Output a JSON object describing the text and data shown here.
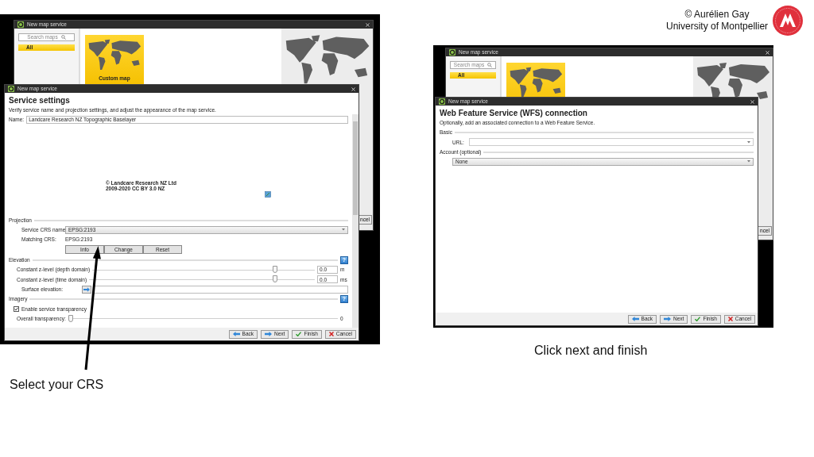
{
  "credit": {
    "lines": [
      "© Aurélien Gay",
      "University of Montpellier"
    ]
  },
  "screenshots": [
    {
      "back_window": {
        "title": "New map service",
        "search": {
          "placeholder": "Search maps"
        },
        "categories": [
          {
            "label": "All",
            "selected": true
          }
        ],
        "tiles": [
          {
            "label": "Custom map"
          }
        ],
        "partial_button": "ncel"
      },
      "front_window": {
        "title": "New map service",
        "heading": "Service settings",
        "description": "Verify service name and projection settings, and adjust the appearance of the map service.",
        "rows": [
          {
            "kind": "text_field",
            "label": "Name:",
            "value": "Landcare Research NZ Topographic Baselayer"
          },
          {
            "kind": "map_preview",
            "attribution": [
              "© Landcare Research NZ Ltd",
              "2009-2020 CC BY 3.0 NZ"
            ]
          },
          {
            "kind": "section",
            "label": "Projection"
          },
          {
            "kind": "dropdown",
            "label": "Service CRS name:",
            "value": "EPSG:2193"
          },
          {
            "kind": "readout",
            "label": "Matching CRS:",
            "value": "EPSG:2193"
          },
          {
            "kind": "buttons",
            "buttons": [
              "Info",
              "Change",
              "Reset"
            ]
          },
          {
            "kind": "section",
            "label": "Elevation",
            "help": "?"
          },
          {
            "kind": "slider",
            "label": "Constant z-level (depth domain)",
            "level": 0.83,
            "value": "0.0",
            "unit": "m"
          },
          {
            "kind": "slider",
            "label": "Constant z-level (time domain)",
            "level": 0.83,
            "value": "0.0",
            "unit": "ms"
          },
          {
            "kind": "picker",
            "label": "Surface elevation:"
          },
          {
            "kind": "section",
            "label": "Imagery",
            "help": "?"
          },
          {
            "kind": "checkbox",
            "label": "Enable service transparency",
            "checked": true
          },
          {
            "kind": "slider",
            "label": "Overall transparency:",
            "level": 0,
            "reading": "0"
          }
        ],
        "buttons": [
          {
            "kind": "back",
            "label": "Back"
          },
          {
            "kind": "next",
            "label": "Next"
          },
          {
            "kind": "finish",
            "label": "Finish"
          },
          {
            "kind": "cancel",
            "label": "Cancel"
          }
        ]
      },
      "caption": "Select your CRS"
    },
    {
      "back_window": {
        "title": "New map service",
        "search": {
          "placeholder": "Search maps"
        },
        "categories": [
          {
            "label": "All",
            "selected": true
          }
        ],
        "tiles_visible": true,
        "partial_button": "ncel"
      },
      "front_window": {
        "title": "New map service",
        "heading": "Web Feature Service (WFS) connection",
        "description": "Optionally, add an associated connection to a Web Feature Service.",
        "rows": [
          {
            "kind": "section",
            "label": "Basic"
          },
          {
            "kind": "combo_box",
            "label": "URL:"
          },
          {
            "kind": "section",
            "label": "Account (optional)"
          },
          {
            "kind": "dropdown",
            "value": "None"
          }
        ],
        "buttons": [
          {
            "kind": "back",
            "label": "Back"
          },
          {
            "kind": "next",
            "label": "Next"
          },
          {
            "kind": "finish",
            "label": "Finish"
          },
          {
            "kind": "cancel",
            "label": "Cancel"
          }
        ]
      },
      "caption": "Click next and finish"
    }
  ]
}
